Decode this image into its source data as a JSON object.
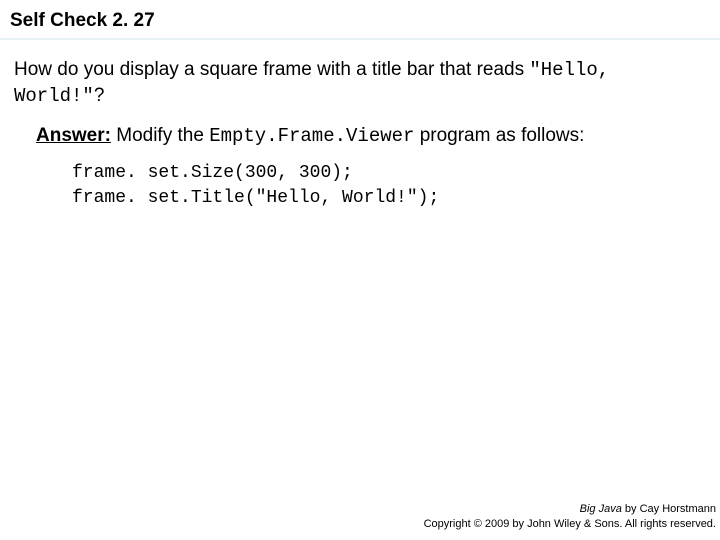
{
  "header": {
    "title": "Self Check 2. 27"
  },
  "question": {
    "part1": "How do you display a square frame with a title bar that reads ",
    "code": "\"Hello, World!\"",
    "part2": "?"
  },
  "answer": {
    "label": "Answer:",
    "text_before_code": " Modify the ",
    "program_name": "Empty.Frame.Viewer",
    "text_after_code": " program as follows:",
    "code_lines": [
      "frame. set.Size(300, 300);",
      "frame. set.Title(\"Hello, World!\");"
    ]
  },
  "footer": {
    "book": "Big Java",
    "author_line": " by Cay Horstmann",
    "copyright": "Copyright © 2009 by John Wiley & Sons. All rights reserved."
  }
}
